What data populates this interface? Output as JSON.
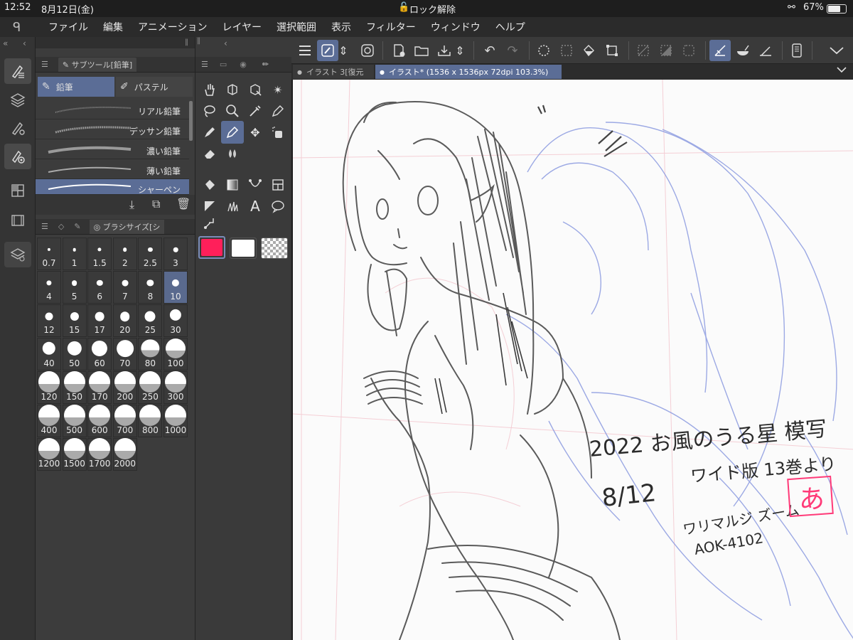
{
  "status": {
    "time": "12:52",
    "date": "8月12日(金)",
    "lock": "ロック解除",
    "battery": "67%"
  },
  "menu": [
    "ファイル",
    "編集",
    "アニメーション",
    "レイヤー",
    "選択範囲",
    "表示",
    "フィルター",
    "ウィンドウ",
    "ヘルプ"
  ],
  "subtool": {
    "title": "サブツール[鉛筆]",
    "tabs": [
      "鉛筆",
      "パステル"
    ],
    "brushes": [
      "リアル鉛筆",
      "デッサン鉛筆",
      "濃い鉛筆",
      "薄い鉛筆",
      "シャーペン"
    ]
  },
  "brushsize": {
    "title": "ブラシサイズ[シ",
    "sizes": [
      "0.7",
      "1",
      "1.5",
      "2",
      "2.5",
      "3",
      "4",
      "5",
      "6",
      "7",
      "8",
      "10",
      "12",
      "15",
      "17",
      "20",
      "25",
      "30",
      "40",
      "50",
      "60",
      "70",
      "80",
      "100",
      "120",
      "150",
      "170",
      "200",
      "250",
      "300",
      "400",
      "500",
      "600",
      "700",
      "800",
      "1000",
      "1200",
      "1500",
      "1700",
      "2000"
    ],
    "selected": "10"
  },
  "colors": {
    "main": "#ff1f5a",
    "sub": "#ffffff",
    "accent": "#5b6d96"
  },
  "tabs": [
    "イラスト 3[復元",
    "イラスト* (1536 x 1536px 72dpi 103.3%)"
  ],
  "annotation": {
    "line1": "2022 お風のうる星 模写",
    "line2": "ワイド版 13巻より",
    "date": "8/12",
    "pen": "ワリマルジ ズーム",
    "code": "AOK-4102",
    "stamp": "あ"
  }
}
